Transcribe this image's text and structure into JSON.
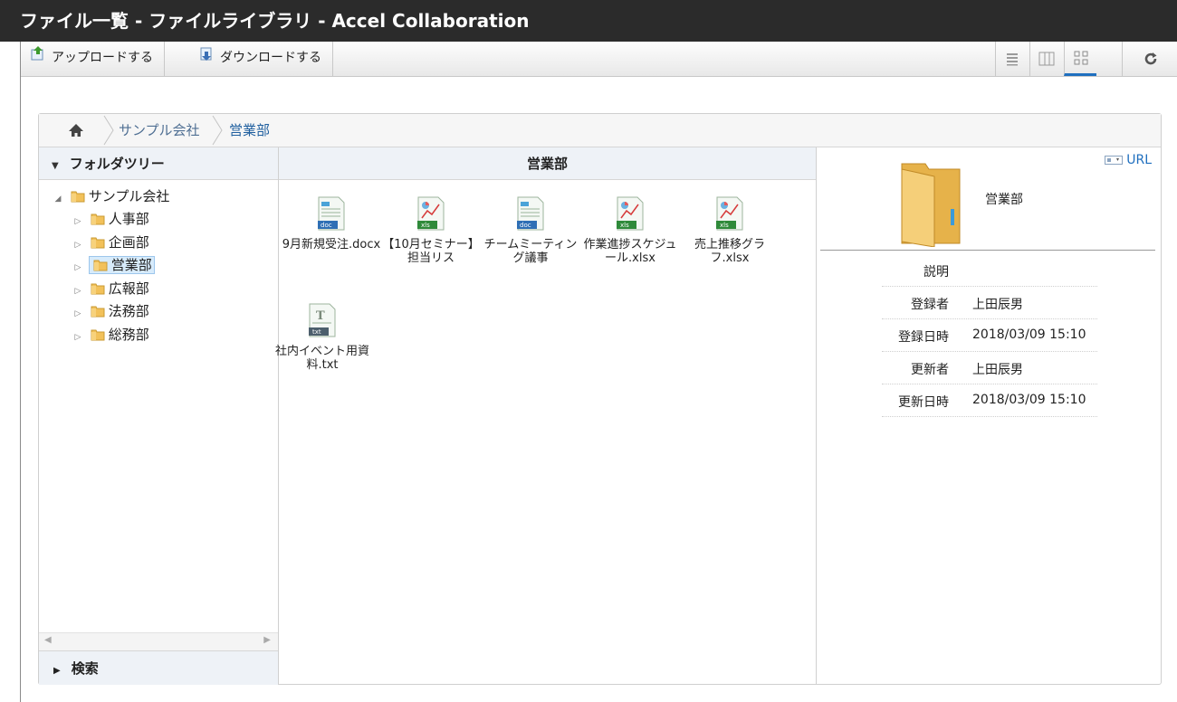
{
  "window": {
    "title": "ファイル一覧 - ファイルライブラリ - Accel Collaboration"
  },
  "toolbar": {
    "upload_label": "アップロードする",
    "download_label": "ダウンロードする",
    "view_buttons": [
      "list-view-icon",
      "columns-view-icon",
      "thumbnail-view-icon",
      "refresh-icon"
    ],
    "active_view": "thumbnail"
  },
  "breadcrumb": {
    "items": [
      "サンプル会社",
      "営業部"
    ]
  },
  "tree": {
    "header": "フォルダツリー",
    "root": "サンプル会社",
    "children": [
      "人事部",
      "企画部",
      "営業部",
      "広報部",
      "法務部",
      "総務部"
    ],
    "selected": "営業部",
    "search_label": "検索"
  },
  "folder_view": {
    "title": "営業部",
    "files": [
      {
        "type": "doc",
        "name": "9月新規受注.docx"
      },
      {
        "type": "xls",
        "name": "【10月セミナー】担当リス"
      },
      {
        "type": "doc",
        "name": "チームミーティング議事"
      },
      {
        "type": "xls",
        "name": "作業進捗スケジュール.xlsx"
      },
      {
        "type": "xls",
        "name": "売上推移グラフ.xlsx"
      },
      {
        "type": "txt",
        "name": "社内イベント用資料.txt"
      }
    ]
  },
  "details": {
    "url_label": "URL",
    "name": "営業部",
    "props": [
      {
        "k": "説明",
        "v": ""
      },
      {
        "k": "登録者",
        "v": "上田辰男"
      },
      {
        "k": "登録日時",
        "v": "2018/03/09 15:10"
      },
      {
        "k": "更新者",
        "v": "上田辰男"
      },
      {
        "k": "更新日時",
        "v": "2018/03/09 15:10"
      }
    ]
  },
  "colors": {
    "accent": "#1f6fbf",
    "folder": "#f2c15a",
    "title_bar": "#2b2b2b",
    "selection": "#d7ebfb"
  }
}
